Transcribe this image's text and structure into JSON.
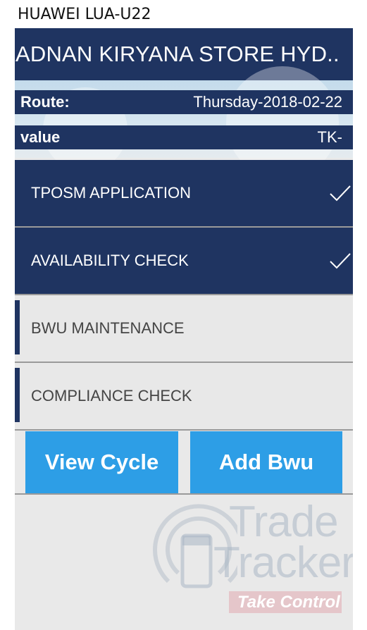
{
  "device": {
    "label": "HUAWEI LUA-U22"
  },
  "header": {
    "title": "ADNAN KIRYANA STORE HYD.."
  },
  "info": {
    "route_label": "Route:",
    "route_value": "Thursday-2018-02-22",
    "value_label": "value",
    "value_value": "TK-"
  },
  "tasks": [
    {
      "label": "TPOSM APPLICATION",
      "completed": true,
      "icon": "check-icon"
    },
    {
      "label": "AVAILABILITY CHECK",
      "completed": true,
      "icon": "check-icon"
    },
    {
      "label": "BWU MAINTENANCE",
      "completed": false
    },
    {
      "label": "COMPLIANCE CHECK",
      "completed": false
    }
  ],
  "actions": {
    "view_cycle": "View Cycle",
    "add_bwu": "Add Bwu"
  },
  "watermark": {
    "line1": "Trade",
    "line2": "Tracker",
    "tagline": "Take Control"
  },
  "colors": {
    "primary": "#1f3461",
    "button": "#2d9ee6",
    "list_bg": "#e8e8e8",
    "text_muted": "#444444"
  }
}
